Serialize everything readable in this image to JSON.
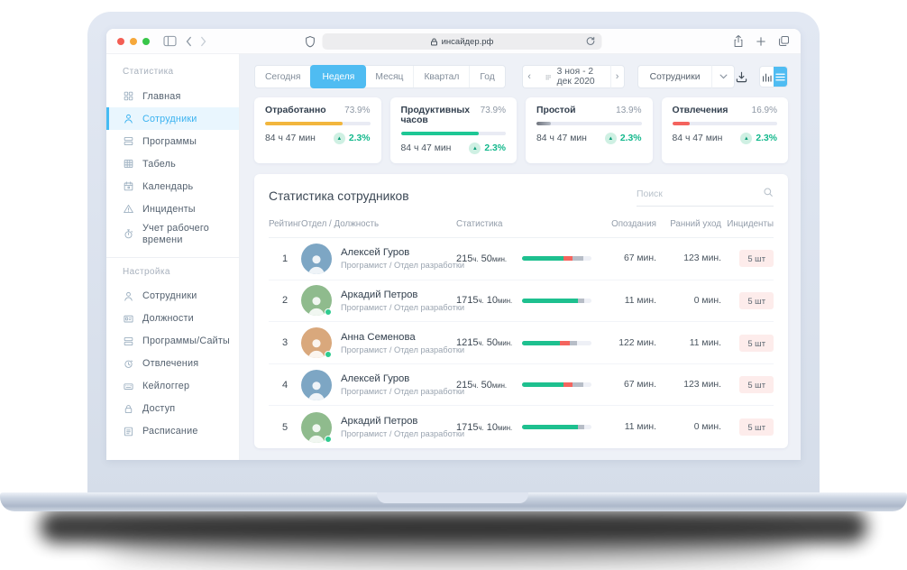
{
  "browser": {
    "url": "инсайдер.рф"
  },
  "sidebar": {
    "sections": [
      {
        "label": "Статистика",
        "items": [
          {
            "label": "Главная",
            "icon": "dashboard-icon"
          },
          {
            "label": "Сотрудники",
            "icon": "user-icon"
          },
          {
            "label": "Программы",
            "icon": "apps-icon"
          },
          {
            "label": "Табель",
            "icon": "table-icon"
          },
          {
            "label": "Календарь",
            "icon": "calendar-icon"
          },
          {
            "label": "Инциденты",
            "icon": "warning-icon"
          },
          {
            "label": "Учет рабочего времени",
            "icon": "stopwatch-icon"
          }
        ]
      },
      {
        "label": "Настройка",
        "items": [
          {
            "label": "Сотрудники",
            "icon": "user-icon"
          },
          {
            "label": "Должности",
            "icon": "id-badge-icon"
          },
          {
            "label": "Программы/Сайты",
            "icon": "apps-icon"
          },
          {
            "label": "Отвлечения",
            "icon": "clock-icon"
          },
          {
            "label": "Кейлоггер",
            "icon": "keyboard-icon"
          },
          {
            "label": "Доступ",
            "icon": "lock-icon"
          },
          {
            "label": "Расписание",
            "icon": "schedule-icon"
          }
        ]
      }
    ]
  },
  "toolbar": {
    "periods": [
      "Сегодня",
      "Неделя",
      "Месяц",
      "Квартал",
      "Год"
    ],
    "active_period": "Неделя",
    "prev": "‹",
    "next": "›",
    "date_range": "3 ноя - 2 дек 2020",
    "entity_filter": "Сотрудники"
  },
  "cards": [
    {
      "title": "Отработанно",
      "percent": "73.9%",
      "progress": 73.9,
      "color": "#f2b63d",
      "value": "84 ч 47 мин",
      "change": "2.3%"
    },
    {
      "title": "Продуктивных часов",
      "percent": "73.9%",
      "progress": 73.9,
      "color": "#1ec795",
      "value": "84 ч 47 мин",
      "change": "2.3%"
    },
    {
      "title": "Простой",
      "percent": "13.9%",
      "progress": 13.9,
      "color": "linear-gradient(90deg,#6f747d,#b6bcc6)",
      "value": "84 ч 47 мин",
      "change": "2.3%"
    },
    {
      "title": "Отвлечения",
      "percent": "16.9%",
      "progress": 16.9,
      "color": "#f4635e",
      "value": "84 ч 47 мин",
      "change": "2.3%"
    }
  ],
  "table": {
    "title": "Статистика сотрудников",
    "search_placeholder": "Поиск",
    "columns": [
      "Рейтинг",
      "Отдел / Должность",
      "Статистика",
      "Опоздания",
      "Ранний уход",
      "Инциденты"
    ],
    "rows": [
      {
        "rank": "1",
        "name": "Алексей Гуров",
        "role": "Програмист / Отдел разработки",
        "h": "215",
        "h_unit": "ч.",
        "m": "50",
        "m_unit": "мин.",
        "bar": {
          "green": 60,
          "red": 13,
          "gray": 15
        },
        "late": "67 мин.",
        "early": "123 мин.",
        "incidents": "5 шт",
        "avatar_color": "#7da6c4"
      },
      {
        "rank": "2",
        "name": "Аркадий Петров",
        "role": "Програмист / Отдел разработки",
        "h": "1715",
        "h_unit": "ч.",
        "m": "10",
        "m_unit": "мин.",
        "bar": {
          "green": 80,
          "red": 0,
          "gray": 9
        },
        "late": "11 мин.",
        "early": "0 мин.",
        "incidents": "5 шт",
        "avatar_color": "#8fbb8d"
      },
      {
        "rank": "3",
        "name": "Анна Семенова",
        "role": "Програмист / Отдел разработки",
        "h": "1215",
        "h_unit": "ч.",
        "m": "50",
        "m_unit": "мин.",
        "bar": {
          "green": 54,
          "red": 15,
          "gray": 10
        },
        "late": "122 мин.",
        "early": "11 мин.",
        "incidents": "5 шт",
        "avatar_color": "#d9a87c"
      },
      {
        "rank": "4",
        "name": "Алексей Гуров",
        "role": "Програмист / Отдел разработки",
        "h": "215",
        "h_unit": "ч.",
        "m": "50",
        "m_unit": "мин.",
        "bar": {
          "green": 60,
          "red": 13,
          "gray": 15
        },
        "late": "67 мин.",
        "early": "123 мин.",
        "incidents": "5 шт",
        "avatar_color": "#7da6c4"
      },
      {
        "rank": "5",
        "name": "Аркадий Петров",
        "role": "Програмист / Отдел разработки",
        "h": "1715",
        "h_unit": "ч.",
        "m": "10",
        "m_unit": "мин.",
        "bar": {
          "green": 80,
          "red": 0,
          "gray": 9
        },
        "late": "11 мин.",
        "early": "0 мин.",
        "incidents": "5 шт",
        "avatar_color": "#8fbb8d"
      }
    ]
  },
  "theme": {
    "accent_blue": "#4fbcf2",
    "green": "#1ec08f",
    "red": "#f4655f",
    "yellow": "#f2b63d",
    "content_bg": "#eef1f7"
  }
}
